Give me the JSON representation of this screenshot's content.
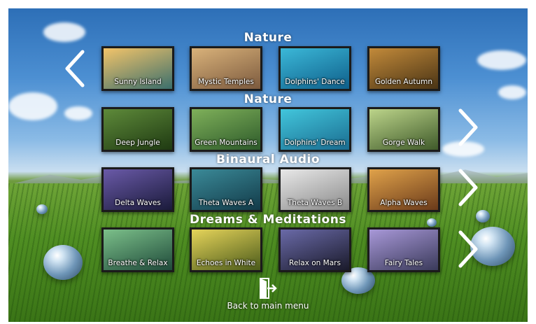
{
  "sections": [
    {
      "title": "Nature",
      "tiles": [
        {
          "label": "Sunny Island",
          "colors": [
            "#f3c46a",
            "#3b6f6c"
          ]
        },
        {
          "label": "Mystic Temples",
          "colors": [
            "#d9b27a",
            "#7c5a3e"
          ]
        },
        {
          "label": "Dolphins' Dance",
          "colors": [
            "#3bb8d8",
            "#0f5f8a"
          ]
        },
        {
          "label": "Golden Autumn",
          "colors": [
            "#c28a3a",
            "#4a3415"
          ]
        }
      ]
    },
    {
      "title": "Nature",
      "tiles": [
        {
          "label": "Deep Jungle",
          "colors": [
            "#5e8a3a",
            "#1f3a12"
          ]
        },
        {
          "label": "Green Mountains",
          "colors": [
            "#7fb05a",
            "#2d5a2a"
          ]
        },
        {
          "label": "Dolphins' Dream",
          "colors": [
            "#42c6dc",
            "#1a6c90"
          ]
        },
        {
          "label": "Gorge Walk",
          "colors": [
            "#bcd48a",
            "#3f5a2a"
          ]
        }
      ]
    },
    {
      "title": "Binaural Audio",
      "tiles": [
        {
          "label": "Delta Waves",
          "colors": [
            "#6a5aa8",
            "#1a1a3a"
          ]
        },
        {
          "label": "Theta Waves A",
          "colors": [
            "#3b8a98",
            "#123a48"
          ]
        },
        {
          "label": "Theta Waves B",
          "colors": [
            "#e8e8e8",
            "#8a8a8a"
          ]
        },
        {
          "label": "Alpha Waves",
          "colors": [
            "#e0a24a",
            "#6a3a1a"
          ]
        }
      ]
    },
    {
      "title": "Dreams & Meditations",
      "tiles": [
        {
          "label": "Breathe & Relax",
          "colors": [
            "#7cc08a",
            "#1f4a3a"
          ]
        },
        {
          "label": "Echoes in White",
          "colors": [
            "#e6d45a",
            "#4a5a1a"
          ]
        },
        {
          "label": "Relax on Mars",
          "colors": [
            "#6a6aa8",
            "#1a1a2a"
          ]
        },
        {
          "label": "Fairy Tales",
          "colors": [
            "#a898d8",
            "#3a3a5a"
          ]
        }
      ]
    }
  ],
  "nav": {
    "prev_icon": "chevron-left-icon",
    "next_icon": "chevron-right-icon"
  },
  "back": {
    "label": "Back to main menu",
    "icon": "exit-door-icon"
  }
}
